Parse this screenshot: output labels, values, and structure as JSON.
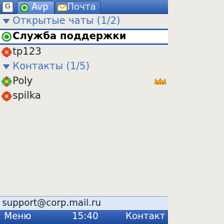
{
  "tabs": {
    "small_tab_label": "G",
    "active_tab": {
      "label": "Avp",
      "icon": "green-status-icon"
    },
    "inactive_tab": {
      "label": "Почта",
      "icon": "envelope-icon"
    }
  },
  "groups": [
    {
      "header": "Открытые чаты (1/2)",
      "items": [
        {
          "name": "Служба поддержки",
          "icon": "online-green-icon",
          "selected": true
        },
        {
          "name": "tp123",
          "icon": "offline-red-flower-icon"
        }
      ]
    },
    {
      "header": "Контакты (1/5)",
      "items": [
        {
          "name": "Poly",
          "icon": "online-green-flower-icon",
          "extra_icon": "crown-icon"
        },
        {
          "name": "spilka",
          "icon": "offline-red-flower-icon"
        }
      ]
    }
  ],
  "status_line": "support@corp.mail.ru",
  "softkeys": {
    "left": "Меню",
    "center": "15:40",
    "right": "Контакт"
  },
  "colors": {
    "accent": "#3b6fbf",
    "online": "#2f9a2f",
    "offline": "#d43a2a",
    "background": "#ecebe6"
  }
}
